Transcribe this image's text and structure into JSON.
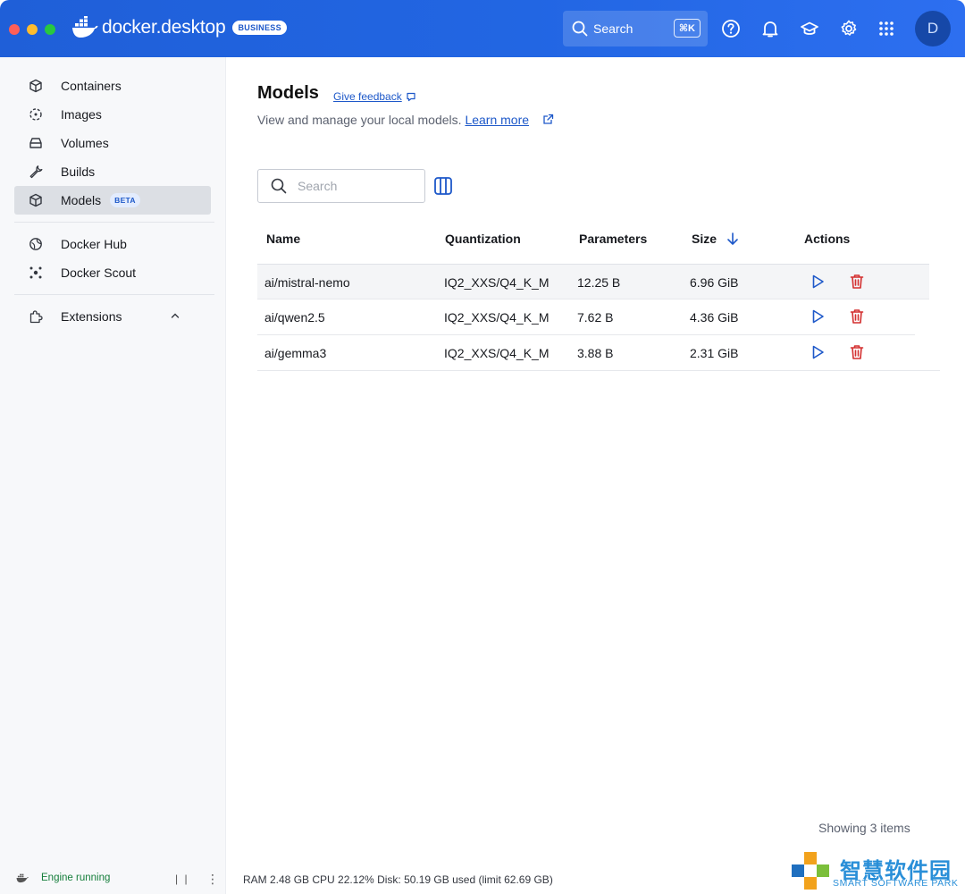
{
  "app": {
    "brand": "docker.desktop",
    "badge": "BUSINESS",
    "search_label": "Search",
    "search_shortcut": "⌘K",
    "avatar_initial": "D",
    "accent": "#2266e3"
  },
  "sidebar": {
    "items": [
      {
        "label": "Containers"
      },
      {
        "label": "Images"
      },
      {
        "label": "Volumes"
      },
      {
        "label": "Builds"
      },
      {
        "label": "Models",
        "badge": "BETA"
      },
      {
        "label": "Docker Hub"
      },
      {
        "label": "Docker Scout"
      },
      {
        "label": "Extensions"
      }
    ]
  },
  "main": {
    "title": "Models",
    "feedback_link": "Give feedback",
    "subtitle": "View and manage your local models.",
    "learn_more": "Learn more",
    "search_placeholder": "Search",
    "columns": [
      "Name",
      "Quantization",
      "Parameters",
      "Size",
      "Actions"
    ],
    "rows": [
      {
        "name": "ai/mistral-nemo",
        "quantization": "IQ2_XXS/Q4_K_M",
        "parameters": "12.25 B",
        "size": "6.96 GiB"
      },
      {
        "name": "ai/qwen2.5",
        "quantization": "IQ2_XXS/Q4_K_M",
        "parameters": "7.62 B",
        "size": "4.36 GiB"
      },
      {
        "name": "ai/gemma3",
        "quantization": "IQ2_XXS/Q4_K_M",
        "parameters": "3.88 B",
        "size": "2.31 GiB"
      }
    ],
    "showing": "Showing 3 items"
  },
  "status": {
    "engine": "Engine running",
    "resources": "RAM 2.48 GB  CPU 22.12%  Disk: 50.19 GB used (limit 62.69 GB)"
  },
  "watermark": {
    "cn": "智慧软件园",
    "en": "SMART SOFTWARE PARK"
  }
}
